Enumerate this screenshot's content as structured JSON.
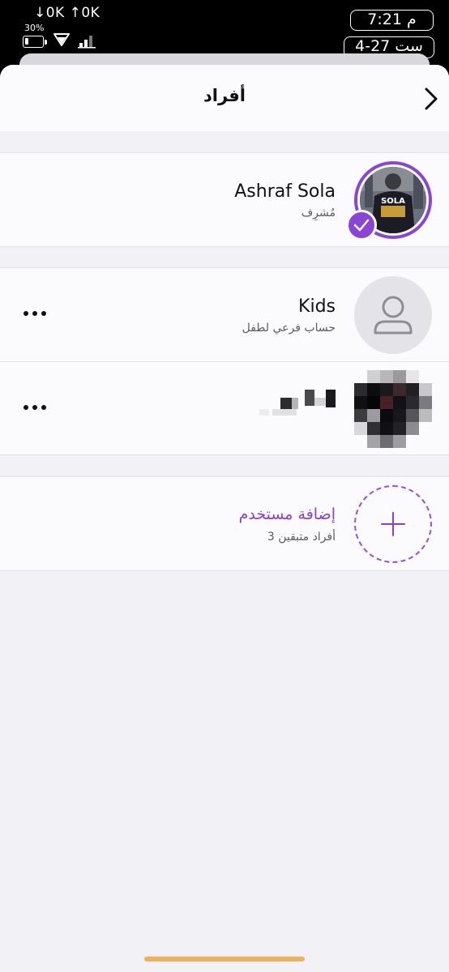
{
  "status_bar": {
    "network_speed": "↓0K ↑0K",
    "battery_percent": "30%",
    "time": "7:21 م",
    "date": "ست 27-4"
  },
  "header": {
    "title": "أفراد"
  },
  "admin": {
    "name": "Ashraf Sola",
    "role": "مُشرِف",
    "shirt_text": "SOLA"
  },
  "members": [
    {
      "name": "Kids",
      "subtitle": "حساب فرعي لطفل"
    }
  ],
  "add_user": {
    "label": "إضافة مستخدم",
    "remaining": "3 أفراد متبقين"
  },
  "colors": {
    "accent": "#8a45d6",
    "home_indicator": "#f0b15a",
    "background": "#f2f1f6",
    "card": "#fbfafd"
  },
  "icons": [
    "back-chevron-icon",
    "checkmark-icon",
    "person-icon",
    "more-icon",
    "plus-icon",
    "wifi-icon",
    "signal-icon",
    "battery-icon"
  ]
}
